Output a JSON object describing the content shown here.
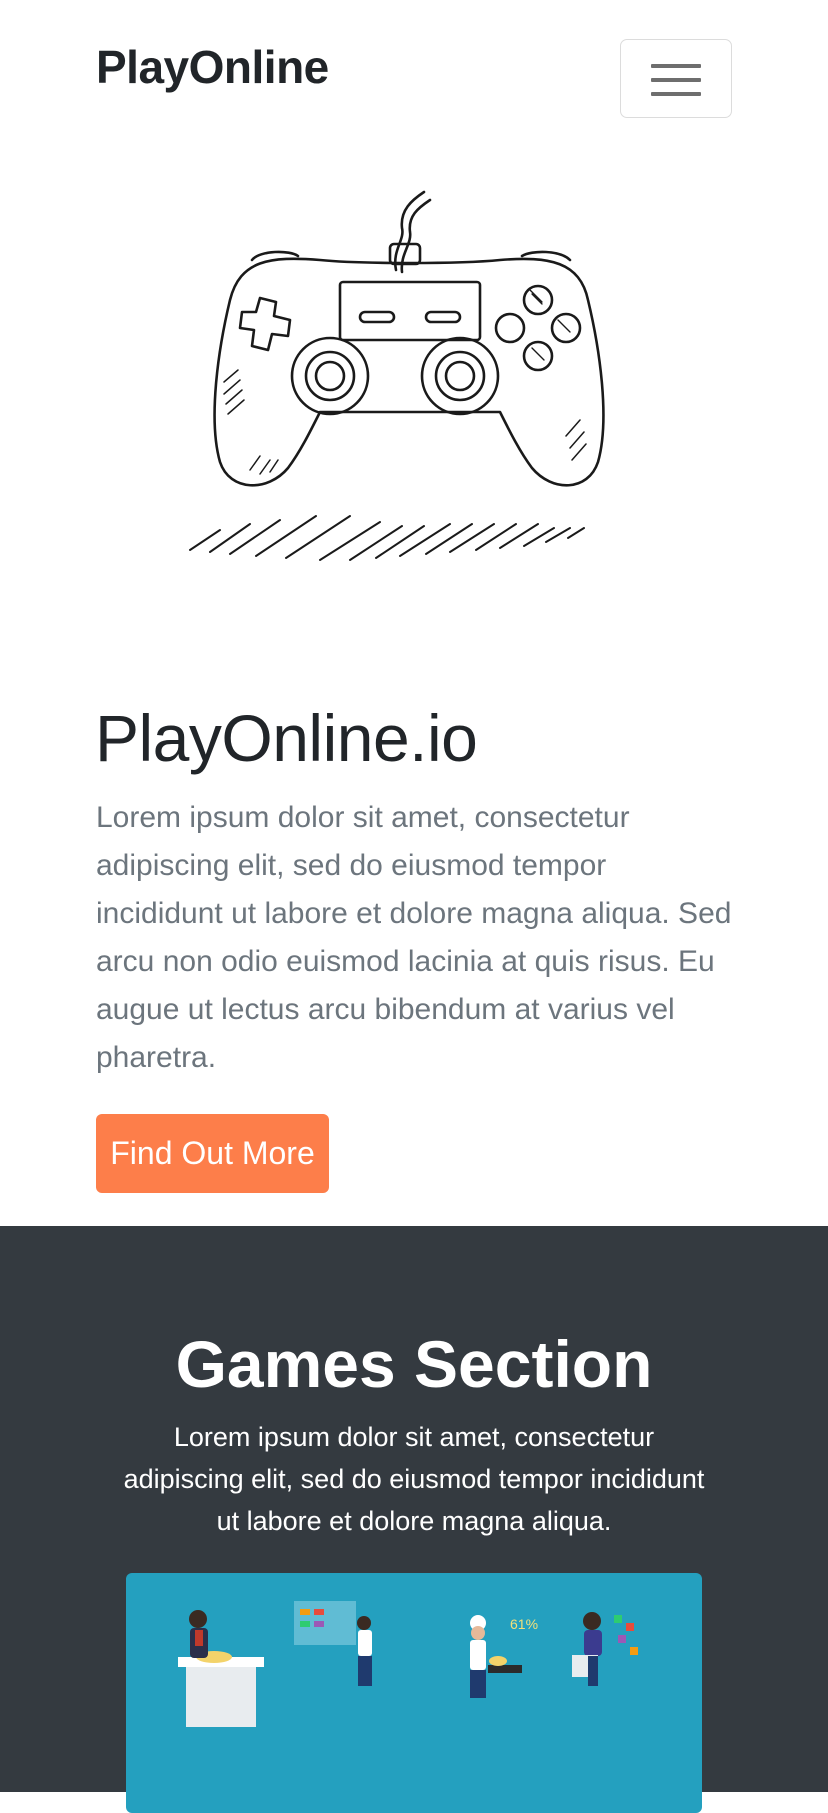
{
  "navbar": {
    "brand": "PlayOnline",
    "toggle_icon": "hamburger-menu-icon"
  },
  "hero": {
    "image": "game-controller-sketch",
    "title": "PlayOnline.io",
    "text": "Lorem ipsum dolor sit amet, consectetur adipiscing elit, sed do eiusmod tempor incididunt ut labore et dolore magna aliqua. Sed arcu non odio euismod lacinia at quis risus. Eu augue ut lectus arcu bibendum at varius vel pharetra.",
    "button_label": "Find Out More",
    "button_color": "#fd7e4a"
  },
  "games": {
    "title": "Games Section",
    "text": "Lorem ipsum dolor sit amet, consectetur adipiscing elit, sed do eiusmod tempor incididunt ut labore et dolore magna aliqua.",
    "background": "#343a40",
    "card_image": "gaming-people-illustration",
    "card_color": "#24a0bf",
    "illustration_label": "61%"
  }
}
